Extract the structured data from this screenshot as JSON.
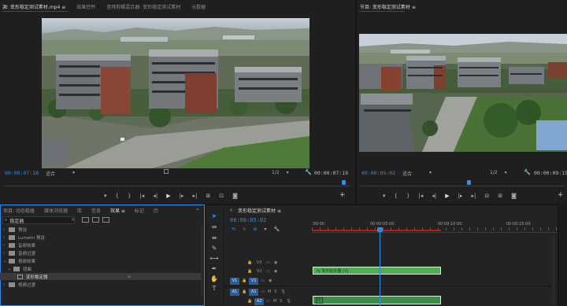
{
  "source_panel": {
    "tabs": [
      "源: 变形稳定测试素材.mp4 ≡",
      "效果控件",
      "音频剪辑混合器: 变形稳定测试素材",
      "元数据"
    ],
    "timecode_left": "00:00:07:18",
    "fit": "适合",
    "resolution": "1/2",
    "timecode_right": "00:00:07:19"
  },
  "program_panel": {
    "tabs": [
      "节目: 变形稳定测试素材 ≡"
    ],
    "timecode_left": "00:00:05:02",
    "fit": "适合",
    "resolution": "1/2",
    "timecode_right": "00:00:09:15"
  },
  "transport": {
    "source_buttons": [
      "▾",
      "{",
      "}",
      "|◂",
      "◂|",
      "▶",
      "|▸",
      "▸|",
      "⊞",
      "⊡",
      "◙"
    ],
    "program_buttons": [
      "▾",
      "{",
      "}",
      "|◂",
      "◂|",
      "▶",
      "|▸",
      "▸|",
      "⊟",
      "⊞",
      "◙"
    ],
    "add_button": "+"
  },
  "effects_panel": {
    "tabs": [
      "项目: 动态稳器",
      "媒体浏览器",
      "库",
      "信息",
      "效果 ≡",
      "标记",
      "历"
    ],
    "search_value": "稳定器",
    "folders": [
      {
        "label": "预设",
        "expanded": false
      },
      {
        "label": "Lumetri 预设",
        "expanded": false
      },
      {
        "label": "音频效果",
        "expanded": false
      },
      {
        "label": "音频过渡",
        "expanded": false
      },
      {
        "label": "视频效果",
        "expanded": true
      },
      {
        "label": "扭曲",
        "expanded": true
      },
      {
        "label": "变形稳定器",
        "expanded": false
      },
      {
        "label": "视频过渡",
        "expanded": false
      }
    ],
    "selected_badge": "▫"
  },
  "timeline": {
    "tab_close": "×",
    "tab_title": "变形稳定测试素材 ≡",
    "timecode": "00:00:05:02",
    "ruler_labels": [
      ":00:00",
      "00:00:05:00",
      "00:00:10:00",
      "00:00:15:00"
    ],
    "tracks": [
      {
        "id": "V3",
        "src": "",
        "kind": "video"
      },
      {
        "id": "V2",
        "src": "",
        "kind": "video"
      },
      {
        "id": "V1",
        "src": "V1",
        "kind": "video"
      },
      {
        "id": "A1",
        "src": "A1",
        "kind": "audio"
      },
      {
        "id": "A2",
        "src": "",
        "kind": "audio"
      }
    ],
    "video_clip_label": "fx 变形稳定器 [V]",
    "audio_clip_label": "fx"
  },
  "colors": {
    "accent": "#2d8ceb",
    "clip_green": "#4fae55",
    "audio_green": "#3a8f47",
    "work_area": "#c01a1a"
  }
}
